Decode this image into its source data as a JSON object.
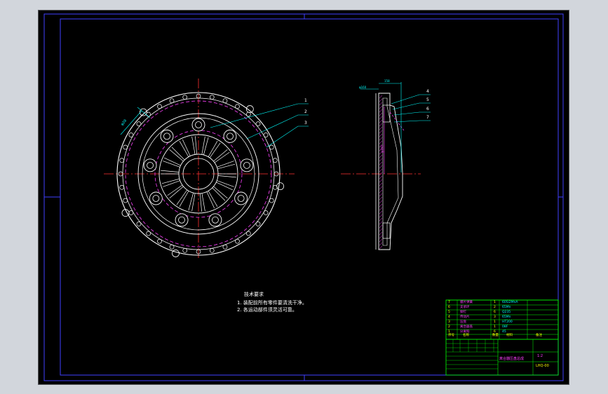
{
  "drawing": {
    "background": "#000000",
    "viewport_color": "#d2d6dc",
    "colors": {
      "border": "#4040ff",
      "part": "#ffffff",
      "center_line": "#ff3030",
      "hidden_line": "#ff40ff",
      "leader": "#00ffff",
      "dimension": "#00ffff",
      "note_text": "#ffffff",
      "table_line": "#00ff00",
      "table_text_yellow": "#ffff00",
      "table_text_magenta": "#ff40ff",
      "table_text_cyan": "#00ffff"
    }
  },
  "front_view": {
    "balloons": [
      "1",
      "2",
      "3"
    ],
    "dimension_label": "φ28"
  },
  "side_view": {
    "balloons": [
      "4",
      "5",
      "6",
      "7"
    ],
    "dimension_labels": [
      "158",
      "φ160",
      "φ200"
    ]
  },
  "notes": {
    "title": "技术要求",
    "lines": [
      "1. 装配前所有零件要清洗干净。",
      "2. 各运动部件须灵活可靠。"
    ]
  },
  "title_block": {
    "parts": [
      {
        "no": "7",
        "name": "膜片弹簧",
        "qty": "1",
        "material": "60Si2MnA"
      },
      {
        "no": "6",
        "name": "支承环",
        "qty": "2",
        "material": "65Mn"
      },
      {
        "no": "5",
        "name": "铆钉",
        "qty": "6",
        "material": "Q235"
      },
      {
        "no": "4",
        "name": "传动片",
        "qty": "3",
        "material": "65Mn"
      },
      {
        "no": "3",
        "name": "压盘",
        "qty": "1",
        "material": "HT200"
      },
      {
        "no": "2",
        "name": "离合器盖",
        "qty": "1",
        "material": "08F"
      },
      {
        "no": "1",
        "name": "分离钩",
        "qty": "6",
        "material": "45"
      }
    ],
    "header": [
      "序号",
      "名称",
      "数量",
      "材料",
      "备注"
    ],
    "drawing_name": "离合器压盘总成",
    "drawing_no": "LHQ-00",
    "scale": "1:2"
  }
}
